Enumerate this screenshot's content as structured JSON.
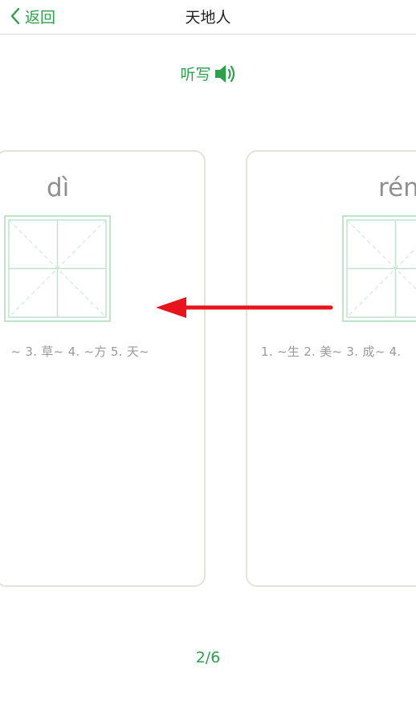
{
  "header": {
    "back_label": "返回",
    "title": "天地人"
  },
  "dictation": {
    "label": "听写"
  },
  "cards": [
    {
      "pinyin": "dì",
      "words": "~ 3. 草~ 4. ~方 5. 天~"
    },
    {
      "pinyin": "rén",
      "words": "1. ~生 2. 美~ 3. 成~ 4."
    }
  ],
  "pager": {
    "text": "2/6"
  },
  "colors": {
    "accent": "#2ca04a",
    "arrow": "#e8131b",
    "card_border": "#e3e4d6",
    "grid": "#bfe3cb"
  }
}
